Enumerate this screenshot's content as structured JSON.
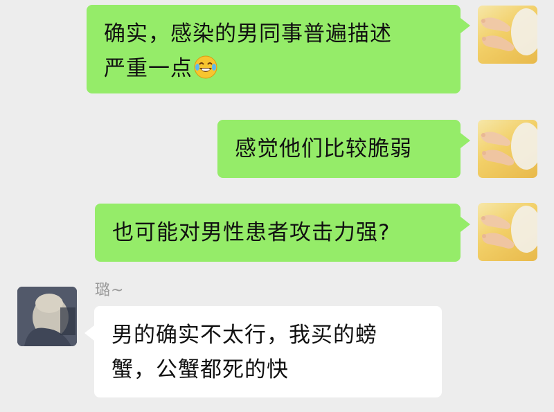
{
  "messages": [
    {
      "side": "outgoing",
      "lines": [
        "确实，感染的男同事普遍描述",
        "严重一点"
      ],
      "emoji": "laughing-tears-emoji"
    },
    {
      "side": "outgoing",
      "lines": [
        "感觉他们比较脆弱"
      ]
    },
    {
      "side": "outgoing",
      "lines": [
        "也可能对男性患者攻击力强?"
      ]
    },
    {
      "side": "incoming",
      "sender": "璐~",
      "lines": [
        "男的确实不太行，我买的螃",
        "蟹，公蟹都死的快"
      ]
    }
  ],
  "avatars": {
    "self": "baby-feet-photo-avatar",
    "other": "person-photo-avatar"
  },
  "colors": {
    "background": "#ededed",
    "outgoing_bubble": "#95ec69",
    "incoming_bubble": "#ffffff",
    "sender_name": "#9a9a9a"
  }
}
